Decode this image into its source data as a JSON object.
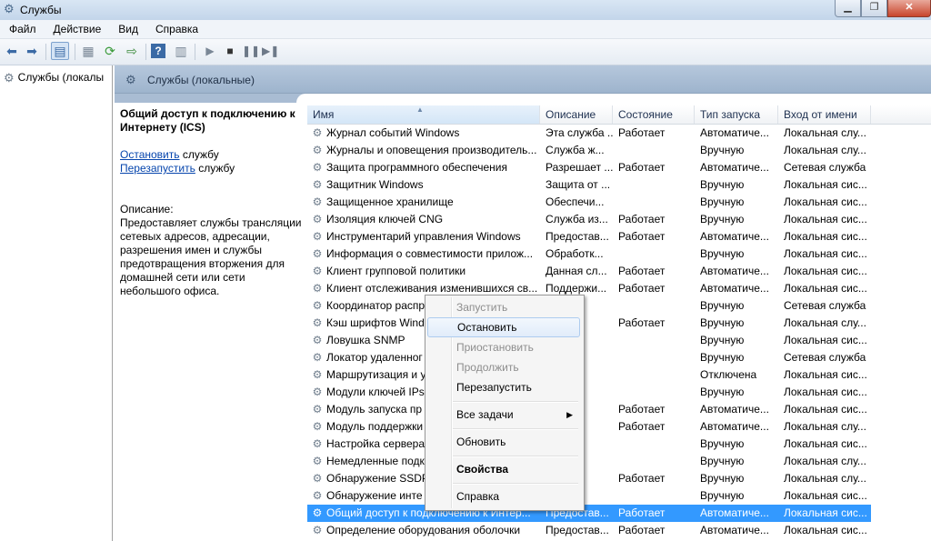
{
  "window": {
    "title": "Службы"
  },
  "menu": [
    "Файл",
    "Действие",
    "Вид",
    "Справка"
  ],
  "tree": {
    "item": "Службы (локалы"
  },
  "panel": {
    "title": "Службы (локальные)"
  },
  "details": {
    "service_title": "Общий доступ к подключению к Интернету (ICS)",
    "stop_link": "Остановить",
    "stop_suffix": " службу",
    "restart_link": "Перезапустить",
    "restart_suffix": " службу",
    "desc_label": "Описание:",
    "desc_text": "Предоставляет службы трансляции сетевых адресов, адресации, разрешения имен и службы предотвращения вторжения для домашней сети или сети небольшого офиса."
  },
  "columns": [
    "Имя",
    "Описание",
    "Состояние",
    "Тип запуска",
    "Вход от имени"
  ],
  "rows": [
    [
      "Журнал событий Windows",
      "Эта служба ...",
      "Работает",
      "Автоматиче...",
      "Локальная слу..."
    ],
    [
      "Журналы и оповещения производитель...",
      "Служба ж...",
      "",
      "Вручную",
      "Локальная слу..."
    ],
    [
      "Защита программного обеспечения",
      "Разрешает ...",
      "Работает",
      "Автоматиче...",
      "Сетевая служба"
    ],
    [
      "Защитник Windows",
      "Защита от ...",
      "",
      "Вручную",
      "Локальная сис..."
    ],
    [
      "Защищенное хранилище",
      "Обеспечи...",
      "",
      "Вручную",
      "Локальная сис..."
    ],
    [
      "Изоляция ключей CNG",
      "Служба из...",
      "Работает",
      "Вручную",
      "Локальная сис..."
    ],
    [
      "Инструментарий управления Windows",
      "Предостав...",
      "Работает",
      "Автоматиче...",
      "Локальная сис..."
    ],
    [
      "Информация о совместимости прилож...",
      "Обработк...",
      "",
      "Вручную",
      "Локальная сис..."
    ],
    [
      "Клиент групповой политики",
      "Данная сл...",
      "Работает",
      "Автоматиче...",
      "Локальная сис..."
    ],
    [
      "Клиент отслеживания изменившихся св...",
      "Поддержи...",
      "Работает",
      "Автоматиче...",
      "Локальная сис..."
    ],
    [
      "Координатор распр",
      "",
      "",
      "Вручную",
      "Сетевая служба"
    ],
    [
      "Кэш шрифтов Wind",
      "",
      "Работает",
      "Вручную",
      "Локальная слу..."
    ],
    [
      "Ловушка SNMP",
      "",
      "",
      "Вручную",
      "Локальная сис..."
    ],
    [
      "Локатор удаленног",
      "ows",
      "",
      "Вручную",
      "Сетевая служба"
    ],
    [
      "Маршрутизация и у",
      "",
      "",
      "Отключена",
      "Локальная сис..."
    ],
    [
      "Модули ключей IPs",
      "IK...",
      "",
      "Вручную",
      "Локальная сис..."
    ],
    [
      "Модуль запуска пр",
      "D...",
      "Работает",
      "Автоматиче...",
      "Локальная сис..."
    ],
    [
      "Модуль поддержки",
      "",
      "Работает",
      "Автоматиче...",
      "Локальная слу..."
    ],
    [
      "Настройка сервера",
      "",
      "",
      "Вручную",
      "Локальная сис..."
    ],
    [
      "Немедленные подк",
      "",
      "",
      "Вручную",
      "Локальная слу..."
    ],
    [
      "Обнаружение SSDP",
      "",
      "Работает",
      "Вручную",
      "Локальная слу..."
    ],
    [
      "Обнаружение инте",
      "е...",
      "",
      "Вручную",
      "Локальная сис..."
    ],
    [
      "Общий доступ к подключению к Интер...",
      "Предостав...",
      "Работает",
      "Автоматиче...",
      "Локальная сис..."
    ],
    [
      "Определение оборудования оболочки",
      "Предостав...",
      "Работает",
      "Автоматиче...",
      "Локальная сис..."
    ]
  ],
  "selected_row": 22,
  "context_menu": {
    "start": "Запустить",
    "stop": "Остановить",
    "pause": "Приостановить",
    "resume": "Продолжить",
    "restart": "Перезапустить",
    "all_tasks": "Все задачи",
    "refresh": "Обновить",
    "properties": "Свойства",
    "help": "Справка"
  }
}
